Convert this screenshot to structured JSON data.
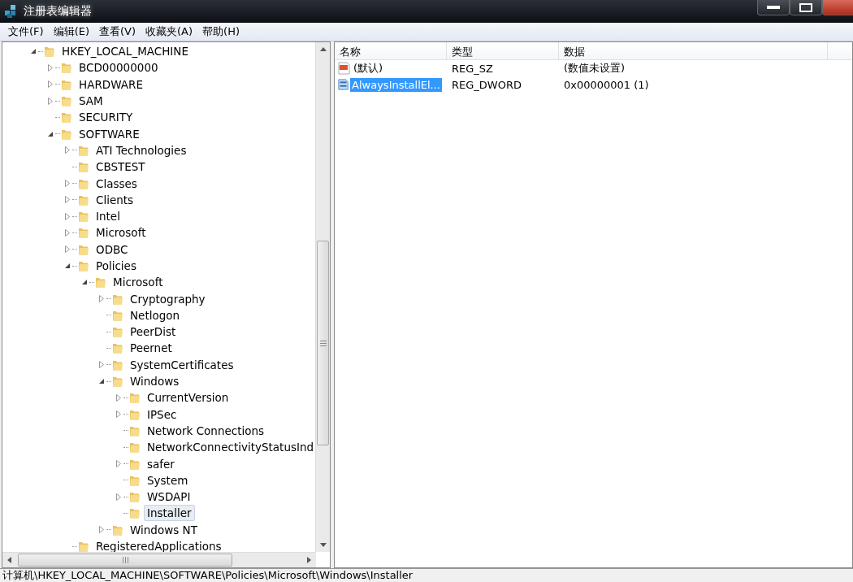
{
  "window": {
    "title": "注册表编辑器"
  },
  "menu": [
    "文件(F)",
    "编辑(E)",
    "查看(V)",
    "收藏夹(A)",
    "帮助(H)"
  ],
  "tree": [
    {
      "label": "HKEY_LOCAL_MACHINE",
      "kind": "expanded",
      "selected": false,
      "children": [
        {
          "label": "BCD00000000",
          "kind": "collapsed",
          "selected": false
        },
        {
          "label": "HARDWARE",
          "kind": "collapsed",
          "selected": false
        },
        {
          "label": "SAM",
          "kind": "collapsed",
          "selected": false
        },
        {
          "label": "SECURITY",
          "kind": "leaf",
          "selected": false
        },
        {
          "label": "SOFTWARE",
          "kind": "expanded",
          "selected": false,
          "children": [
            {
              "label": "ATI Technologies",
              "kind": "collapsed",
              "selected": false
            },
            {
              "label": "CBSTEST",
              "kind": "leaf",
              "selected": false
            },
            {
              "label": "Classes",
              "kind": "collapsed",
              "selected": false
            },
            {
              "label": "Clients",
              "kind": "collapsed",
              "selected": false
            },
            {
              "label": "Intel",
              "kind": "collapsed",
              "selected": false
            },
            {
              "label": "Microsoft",
              "kind": "collapsed",
              "selected": false
            },
            {
              "label": "ODBC",
              "kind": "collapsed",
              "selected": false
            },
            {
              "label": "Policies",
              "kind": "expanded",
              "selected": false,
              "children": [
                {
                  "label": "Microsoft",
                  "kind": "expanded",
                  "selected": false,
                  "children": [
                    {
                      "label": "Cryptography",
                      "kind": "collapsed",
                      "selected": false
                    },
                    {
                      "label": "Netlogon",
                      "kind": "leaf",
                      "selected": false
                    },
                    {
                      "label": "PeerDist",
                      "kind": "leaf",
                      "selected": false
                    },
                    {
                      "label": "Peernet",
                      "kind": "leaf",
                      "selected": false
                    },
                    {
                      "label": "SystemCertificates",
                      "kind": "collapsed",
                      "selected": false
                    },
                    {
                      "label": "Windows",
                      "kind": "expanded",
                      "selected": false,
                      "children": [
                        {
                          "label": "CurrentVersion",
                          "kind": "collapsed",
                          "selected": false
                        },
                        {
                          "label": "IPSec",
                          "kind": "collapsed",
                          "selected": false
                        },
                        {
                          "label": "Network Connections",
                          "kind": "leaf",
                          "selected": false
                        },
                        {
                          "label": "NetworkConnectivityStatusInd",
                          "kind": "leaf",
                          "selected": false
                        },
                        {
                          "label": "safer",
                          "kind": "collapsed",
                          "selected": false
                        },
                        {
                          "label": "System",
                          "kind": "leaf",
                          "selected": false
                        },
                        {
                          "label": "WSDAPI",
                          "kind": "collapsed",
                          "selected": false
                        },
                        {
                          "label": "Installer",
                          "kind": "leaf",
                          "selected": true
                        }
                      ]
                    },
                    {
                      "label": "Windows NT",
                      "kind": "collapsed",
                      "selected": false
                    }
                  ]
                }
              ]
            },
            {
              "label": "RegisteredApplications",
              "kind": "leaf",
              "selected": false
            }
          ]
        }
      ]
    }
  ],
  "values": {
    "columns": [
      "名称",
      "类型",
      "数据"
    ],
    "rows": [
      {
        "name": "(默认)",
        "type": "REG_SZ",
        "data": "(数值未设置)",
        "kind": "string",
        "selected": false
      },
      {
        "name": "AlwaysInstallEl...",
        "type": "REG_DWORD",
        "data": "0x00000001 (1)",
        "kind": "dword",
        "selected": true
      }
    ]
  },
  "status_bar": "计算机\\HKEY_LOCAL_MACHINE\\SOFTWARE\\Policies\\Microsoft\\Windows\\Installer"
}
